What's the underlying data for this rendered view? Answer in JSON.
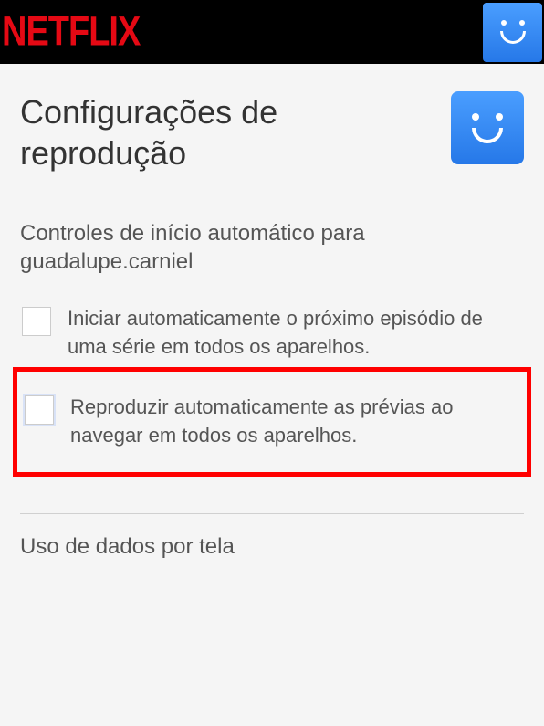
{
  "header": {
    "logo": "NETFLIX"
  },
  "page": {
    "title": "Configurações de reprodução"
  },
  "autoplay": {
    "section_title": "Controles de início automático para guadalupe.carniel",
    "option1_label": "Iniciar automaticamente o próximo episódio de uma série em todos os aparelhos.",
    "option2_label": "Reproduzir automaticamente as prévias ao navegar em todos os aparelhos."
  },
  "data_usage": {
    "section_title": "Uso de dados por tela"
  }
}
